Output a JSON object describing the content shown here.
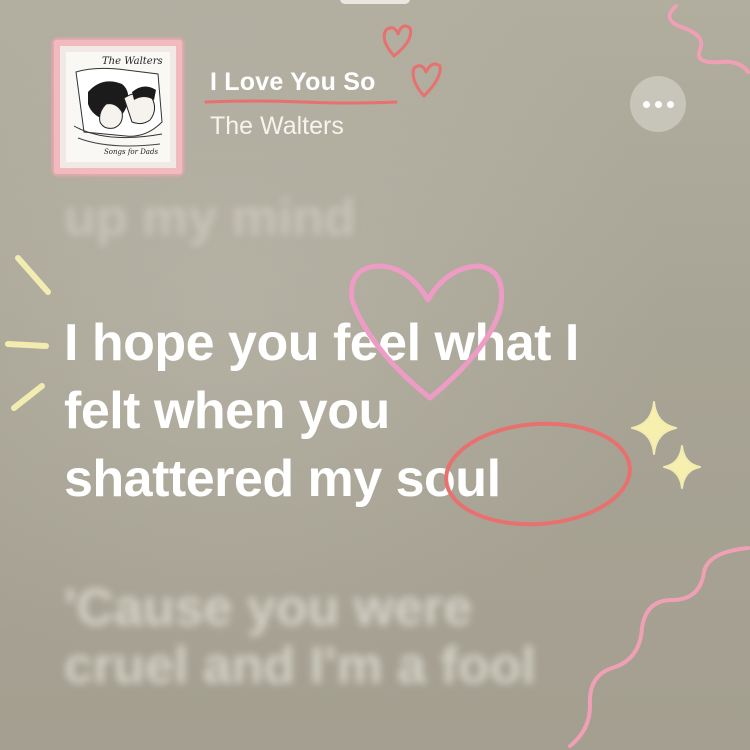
{
  "track": {
    "title": "I Love You So",
    "artist": "The Walters"
  },
  "album_art": {
    "cover_title": "The Walters",
    "cover_subtitle": "Songs for Dads"
  },
  "lyrics": {
    "previous_line": "up my mind",
    "current_lines": [
      "I hope you feel what I",
      "felt when you",
      "shattered my soul"
    ],
    "next_lines": [
      "'Cause you were",
      "cruel and I'm a fool"
    ]
  },
  "controls": {
    "more_icon": "more-horizontal-icon"
  },
  "colors": {
    "background": "#a9a596",
    "pink_doodle": "#f0a8c8",
    "red_doodle": "#e8716f",
    "yellow_doodle": "#f3ecb0"
  }
}
